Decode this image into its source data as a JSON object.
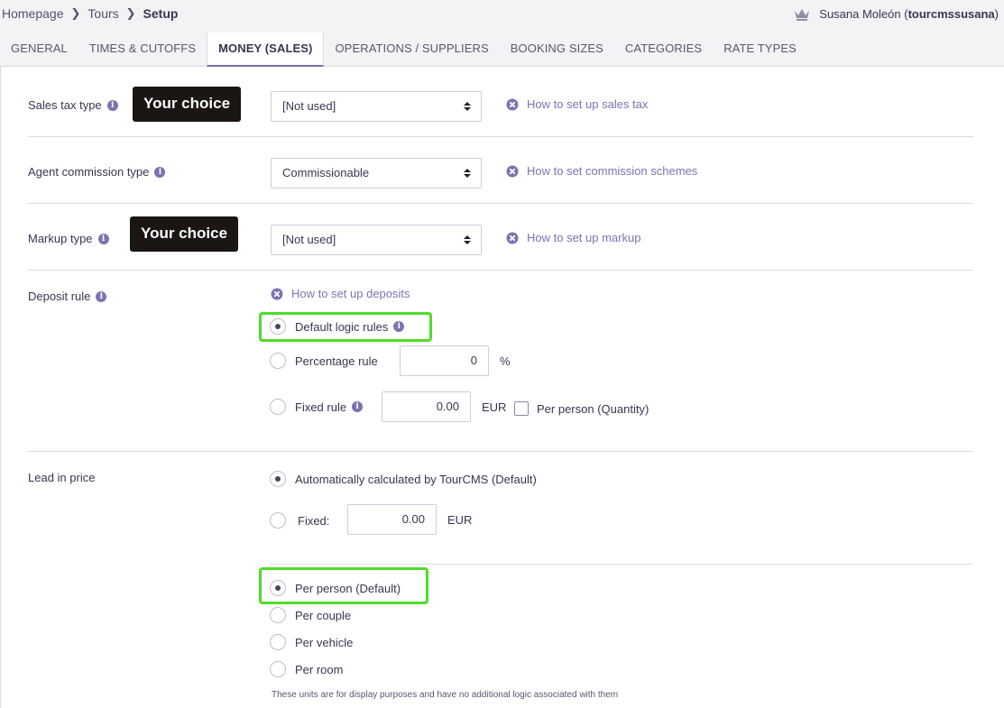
{
  "breadcrumb": {
    "home": "Homepage",
    "tours": "Tours",
    "current": "Setup",
    "sep": ">"
  },
  "user": {
    "name": "Susana Moleón (",
    "username": "tourcmssusana",
    "close": ")",
    "icon": "crown-icon"
  },
  "tabs": [
    {
      "label": "GENERAL"
    },
    {
      "label": "TIMES & CUTOFFS"
    },
    {
      "label": "MONEY (SALES)",
      "active": true
    },
    {
      "label": "OPERATIONS / SUPPLIERS"
    },
    {
      "label": "BOOKING SIZES"
    },
    {
      "label": "CATEGORIES"
    },
    {
      "label": "RATE TYPES"
    }
  ],
  "sales_tax": {
    "label": "Sales tax type",
    "badge": "Your choice",
    "value": "[Not used]",
    "help": "How to set up sales tax"
  },
  "agent_commission": {
    "label": "Agent commission type",
    "value": "Commissionable",
    "help": "How to set commission schemes"
  },
  "markup": {
    "label": "Markup type",
    "badge": "Your choice",
    "value": "[Not used]",
    "help": "How to set up markup"
  },
  "deposit": {
    "label": "Deposit rule",
    "help": "How to set up deposits",
    "default_label": "Default logic rules",
    "percentage_label": "Percentage rule",
    "percentage_value": "0",
    "percentage_unit": "%",
    "fixed_label": "Fixed rule",
    "fixed_value": "0.00",
    "fixed_unit": "EUR",
    "per_person_label": "Per person (Quantity)"
  },
  "lead_price": {
    "label": "Lead in price",
    "auto_label": "Automatically calculated by TourCMS (Default)",
    "fixed_label": "Fixed:",
    "fixed_value": "0.00",
    "fixed_unit": "EUR",
    "per_person": "Per person (Default)",
    "per_couple": "Per couple",
    "per_vehicle": "Per vehicle",
    "per_room": "Per room",
    "note": "These units are for display purposes and have no additional logic associated with them"
  },
  "colors": {
    "accent": "#7d72b2",
    "highlight": "#4fdc2a",
    "badge_bg": "#1b1514"
  }
}
